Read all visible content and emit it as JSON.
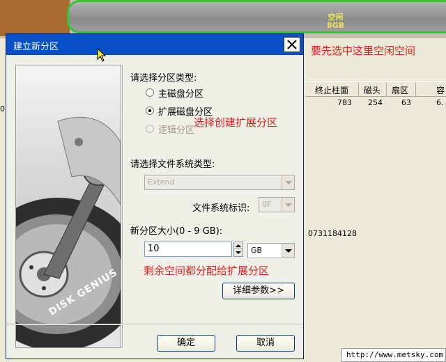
{
  "background": {
    "disk_bar_label": "空闲\n8GB",
    "edge_text": "0",
    "table_headers": [
      "终止柱面",
      "磁头",
      "扇区",
      "容"
    ],
    "table_row": [
      "783",
      "254",
      "63",
      "6."
    ],
    "serial": "0731184128"
  },
  "annotations": {
    "select_free_space": "要先选中这里空闲空间",
    "choose_extended": "选择创建扩展分区",
    "allocate_remaining": "剩余空间都分配给扩展分区"
  },
  "dialog": {
    "title": "建立新分区",
    "image_brand": "DISK GENIUS",
    "partition_type_label": "请选择分区类型:",
    "options": [
      {
        "label": "主磁盘分区",
        "checked": false,
        "enabled": true
      },
      {
        "label": "扩展磁盘分区",
        "checked": true,
        "enabled": true
      },
      {
        "label": "逻辑分区",
        "checked": false,
        "enabled": false
      }
    ],
    "fs_type_label": "请选择文件系统类型:",
    "fs_type_value": "Extend",
    "fs_id_label": "文件系统标识:",
    "fs_id_value": "0F",
    "size_label": "新分区大小(0 - 9 GB):",
    "size_value": "10",
    "size_unit": "GB",
    "details_button": "详细参数>>",
    "ok_button": "确定",
    "cancel_button": "取消"
  },
  "watermark": "http://www.metsky.com",
  "colors": {
    "annotation_red": "#e0201c",
    "titlebar_blue": "#0850c8",
    "disk_bar_border": "#34c534"
  },
  "icons": [
    "close-icon",
    "mouse-cursor-icon",
    "hard-disk-illustration"
  ]
}
